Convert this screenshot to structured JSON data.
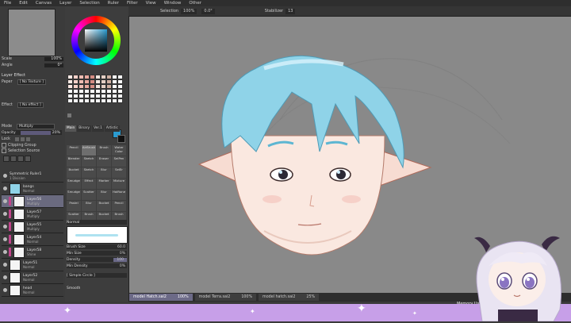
{
  "menu": [
    "File",
    "Edit",
    "Canvas",
    "Layer",
    "Selection",
    "Ruler",
    "Filter",
    "View",
    "Window",
    "Other"
  ],
  "left": {
    "scale_label": "Scale",
    "scale_value": "100%",
    "angle_label": "Angle",
    "angle_value": "0°",
    "layer_effect_title": "Layer Effect",
    "paper_label": "Paper",
    "paper_value": "[ No Texture ]",
    "effect_label": "Effect",
    "effect_value": "[ No effect ]",
    "mode_label": "Mode",
    "mode_value": "Multiply",
    "opacity_label": "Opacity",
    "opacity_value": "20%",
    "lock_label": "Lock",
    "clipping_label": "Clipping Group",
    "selection_source_label": "Selection Source",
    "layers": [
      {
        "name": "Symmetric Ruler1",
        "mode": "1 Division",
        "sel": false
      },
      {
        "name": "bangs",
        "mode": "Normal",
        "opacity": "100%",
        "sel": false
      },
      {
        "name": "Layer56",
        "mode": "Multiply",
        "sel": true
      },
      {
        "name": "Layer57",
        "mode": "Multiply",
        "sel": false
      },
      {
        "name": "Layer55",
        "mode": "Multiply",
        "sel": false
      },
      {
        "name": "Layer54",
        "mode": "Normal",
        "opacity": "100%",
        "sel": false
      },
      {
        "name": "Layer58",
        "mode": "Shine",
        "sel": false
      },
      {
        "name": "Layer51",
        "mode": "Normal",
        "opacity": "100%",
        "sel": false
      },
      {
        "name": "Layer52",
        "mode": "Normal",
        "sel": false
      },
      {
        "name": "head",
        "mode": "Normal",
        "sel": false
      }
    ]
  },
  "tools": {
    "tabs": [
      "Main",
      "Binary",
      "Ver.1",
      "Artistic"
    ],
    "active_tab": "Main",
    "items": [
      "Pencil",
      "AirBrush",
      "Brush",
      "Water Color",
      "Blender",
      "Sketch",
      "Eraser",
      "SelPen",
      "Bucket",
      "Sketch",
      "Blur",
      "SelEr",
      "Smudge",
      "Effect",
      "Marker",
      "Mixture",
      "Smudge",
      "Scatter",
      "Blur",
      "Halftone",
      "Pastel",
      "Blur",
      "Bucket",
      "Pencil",
      "Scatter",
      "Brush",
      "Bucket",
      "Brush"
    ],
    "active_tool": "AirBrush",
    "blend_mode": "Normal",
    "brush_size_label": "Brush Size",
    "brush_size_value": "60.0",
    "min_size_label": "Min Size",
    "min_size_value": "0%",
    "density_label": "Density",
    "density_value": "100",
    "min_density_label": "Min Density",
    "min_density_value": "0%",
    "shape_value": "[ Simple Circle ]",
    "smooth_label": "Smooth"
  },
  "toolbar": {
    "selection_label": "Selection",
    "zoom_value": "100%",
    "rotate_value": "0.0°",
    "stabilizer_label": "Stabilizer",
    "stabilizer_value": "13"
  },
  "documents": [
    {
      "name": "model Hatch.sai2",
      "zoom": "100%",
      "active": true
    },
    {
      "name": "model Terra.sai2",
      "zoom": "100%",
      "active": false
    },
    {
      "name": "model hatch.sai2",
      "zoom": "25%",
      "active": false
    }
  ],
  "status": {
    "memory": "Memory Us"
  },
  "colors": {
    "accent": "#6c6a87",
    "hair": "#8fd3e8",
    "bottom_strip": "#c79fe8",
    "current_color": "#2a9bd0"
  }
}
